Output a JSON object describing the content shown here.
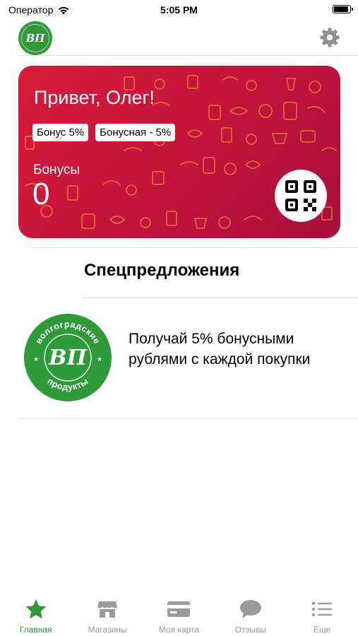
{
  "status_bar": {
    "carrier": "Оператор",
    "time": "5:05 PM",
    "battery_level": 1.0
  },
  "header": {
    "logo_text": "ВП",
    "settings_icon": "gear-icon"
  },
  "card": {
    "greeting": "Привет, Олег!",
    "chips": [
      "Бонус 5%",
      "Бонусная - 5%"
    ],
    "bonus_label": "Бонусы",
    "bonus_value": "0",
    "qr_icon": "qr-code-icon",
    "background_color": "#d81b3a"
  },
  "section": {
    "title": "Спецпредложения"
  },
  "offer": {
    "logo_top_text": "волгоградские",
    "logo_center_text": "ВП",
    "logo_bottom_text": "продукты",
    "text": "Получай 5% бонусными рублями с каждой покупки"
  },
  "tabbar": {
    "active_color": "#2f9a3a",
    "items": [
      {
        "label": "Главная",
        "icon": "star-icon"
      },
      {
        "label": "Магазины",
        "icon": "store-icon"
      },
      {
        "label": "Моя карта",
        "icon": "card-icon"
      },
      {
        "label": "Отзывы",
        "icon": "chat-bubble-icon"
      },
      {
        "label": "Еще",
        "icon": "list-icon"
      }
    ]
  }
}
